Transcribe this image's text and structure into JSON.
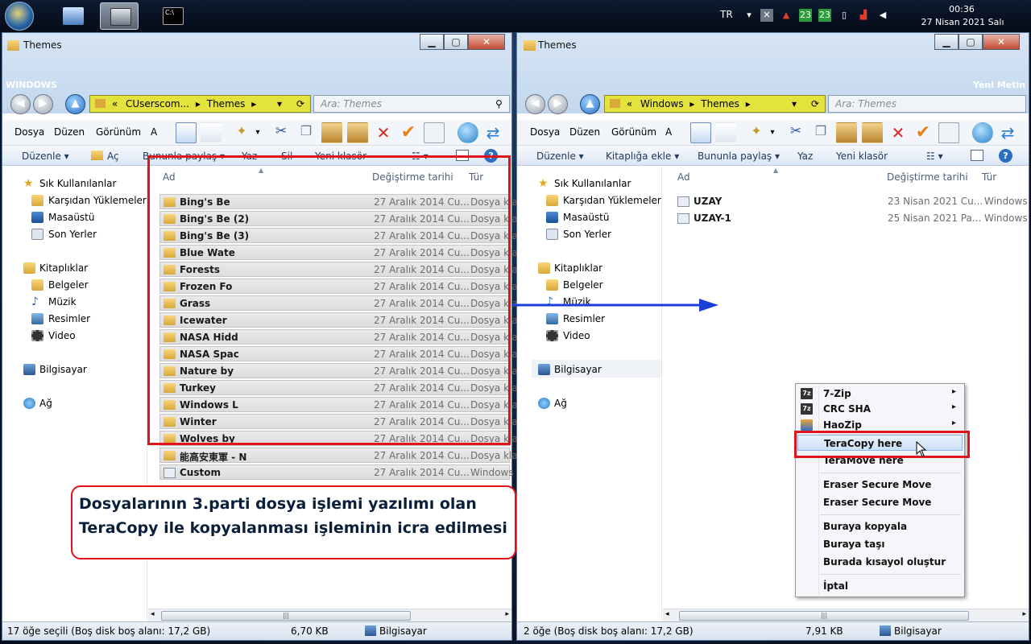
{
  "taskbar": {
    "language": "TR",
    "tray_badge_1": "23",
    "tray_badge_2": "23",
    "time": "00:36",
    "date": "27 Nisan 2021 Salı"
  },
  "desktop": {
    "label_left": "WINDOWS",
    "label_right": "Yeni Metin"
  },
  "left_window": {
    "title": "Themes",
    "address_prefix": "«",
    "address_part_1": "CUserscom...",
    "address_part_2": "Themes",
    "search_placeholder": "Ara: Themes",
    "menu": [
      "Dosya",
      "Düzen",
      "Görünüm",
      "A"
    ],
    "commands": [
      "Düzenle ▾",
      "Aç",
      "Bununla paylaş ▾",
      "Yaz",
      "Sil",
      "Yeni klasör"
    ],
    "nav": {
      "favorites": "Sık Kullanılanlar",
      "downloads": "Karşıdan Yüklemeler",
      "desktop": "Masaüstü",
      "recent": "Son Yerler",
      "libraries": "Kitaplıklar",
      "documents": "Belgeler",
      "music": "Müzik",
      "pictures": "Resimler",
      "video": "Video",
      "computer": "Bilgisayar",
      "network": "Ağ"
    },
    "columns": {
      "name": "Ad",
      "modified": "Değiştirme tarihi",
      "type": "Tür"
    },
    "files": [
      {
        "name": "Bing's Be",
        "date": "27 Aralık 2014 Cu...",
        "type": "Dosya kla"
      },
      {
        "name": "Bing's Be (2)",
        "date": "27 Aralık 2014 Cu...",
        "type": "Dosya kla"
      },
      {
        "name": "Bing's Be (3)",
        "date": "27 Aralık 2014 Cu...",
        "type": "Dosya kla"
      },
      {
        "name": "Blue Wate",
        "date": "27 Aralık 2014 Cu...",
        "type": "Dosya kla"
      },
      {
        "name": "Forests",
        "date": "27 Aralık 2014 Cu...",
        "type": "Dosya kla"
      },
      {
        "name": "Frozen Fo",
        "date": "27 Aralık 2014 Cu...",
        "type": "Dosya kla"
      },
      {
        "name": "Grass",
        "date": "27 Aralık 2014 Cu...",
        "type": "Dosya kla"
      },
      {
        "name": "Icewater",
        "date": "27 Aralık 2014 Cu...",
        "type": "Dosya kla"
      },
      {
        "name": "NASA Hidd",
        "date": "27 Aralık 2014 Cu...",
        "type": "Dosya kla"
      },
      {
        "name": "NASA Spac",
        "date": "27 Aralık 2014 Cu...",
        "type": "Dosya kla"
      },
      {
        "name": "Nature by",
        "date": "27 Aralık 2014 Cu...",
        "type": "Dosya kla"
      },
      {
        "name": "Turkey",
        "date": "27 Aralık 2014 Cu...",
        "type": "Dosya kla"
      },
      {
        "name": "Windows L",
        "date": "27 Aralık 2014 Cu...",
        "type": "Dosya kla"
      },
      {
        "name": "Winter",
        "date": "27 Aralık 2014 Cu...",
        "type": "Dosya kla"
      },
      {
        "name": "Wolves by",
        "date": "27 Aralık 2014 Cu...",
        "type": "Dosya kla"
      },
      {
        "name": "能高安東軍 - N",
        "date": "27 Aralık 2014 Cu...",
        "type": "Dosya kla"
      },
      {
        "name": "Custom",
        "date": "27 Aralık 2014 Cu...",
        "type": "Windows"
      }
    ],
    "status": {
      "selection": "17 öğe seçili (Boş disk boş alanı: 17,2 GB)",
      "size": "6,70 KB",
      "location": "Bilgisayar"
    }
  },
  "right_window": {
    "title": "Themes",
    "address_prefix": "«",
    "address_part_1": "Windows",
    "address_part_2": "Themes",
    "search_placeholder": "Ara: Themes",
    "menu": [
      "Dosya",
      "Düzen",
      "Görünüm",
      "A"
    ],
    "commands": [
      "Düzenle ▾",
      "Kitaplığa ekle ▾",
      "Bununla paylaş ▾",
      "Yaz",
      "Yeni klasör"
    ],
    "columns": {
      "name": "Ad",
      "modified": "Değiştirme tarihi",
      "type": "Tür"
    },
    "files": [
      {
        "name": "UZAY",
        "date": "23 Nisan 2021 Cu...",
        "type": "Windows"
      },
      {
        "name": "UZAY-1",
        "date": "25 Nisan 2021 Pa...",
        "type": "Windows"
      }
    ],
    "status": {
      "selection": "2 öğe (Boş disk boş alanı: 17,2 GB)",
      "size": "7,91 KB",
      "location": "Bilgisayar"
    }
  },
  "context_menu": {
    "items": [
      {
        "label": "7-Zip",
        "icon": "7z",
        "submenu": true
      },
      {
        "label": "CRC SHA",
        "icon": "7z",
        "submenu": true
      },
      {
        "label": "HaoZip",
        "icon": "hz",
        "submenu": true
      },
      {
        "label": "TeraCopy here",
        "highlighted": true
      },
      {
        "label": "TeraMove here"
      },
      {
        "label": "Eraser Secure Move"
      },
      {
        "label": "Eraser Secure Move"
      },
      {
        "label": "Buraya kopyala"
      },
      {
        "label": "Buraya taşı"
      },
      {
        "label": "Burada kısayol oluştur"
      },
      {
        "label": "İptal"
      }
    ],
    "submenu_arrow": "▸"
  },
  "callout": {
    "line_1": "Dosyalarının 3.parti dosya işlemi yazılımı olan",
    "line_2": "TeraCopy ile kopyalanması işleminin icra edilmesi"
  },
  "colors": {
    "highlight_red": "#e0141b",
    "arrow_blue": "#1a3fd6",
    "address_yellow": "#e4e23c"
  }
}
